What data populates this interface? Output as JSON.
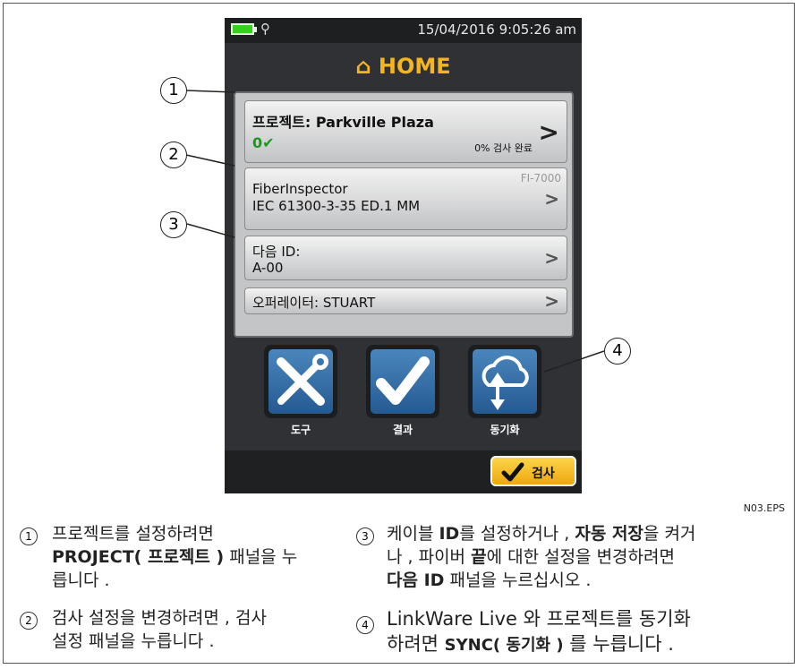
{
  "status": {
    "datetime": "15/04/2016 9:05:26 am"
  },
  "header": {
    "title": "HOME"
  },
  "project": {
    "title": "프로젝트: Parkville Plaza",
    "count": "0✔",
    "pct": "0% 검사 완료"
  },
  "test_setup": {
    "line1": "FiberInspector",
    "line2": "IEC 61300-3-35 ED.1 MM",
    "tag": "FI-7000"
  },
  "next_id": {
    "line1": "다음 ID:",
    "line2": "A-00"
  },
  "operator": {
    "label": "오퍼레이터: STUART"
  },
  "buttons": {
    "tools": "도구",
    "results": "결과",
    "sync": "동기화",
    "test": "검사"
  },
  "figure_id": "N03.EPS",
  "callouts": [
    "1",
    "2",
    "3",
    "4"
  ],
  "captions": {
    "c1_a": "프로젝트를 설정하려면",
    "c1_b_bold": "PROJECT( 프로젝트 )",
    "c1_b_rest": " 패널을 누",
    "c1_c": "릅니다 .",
    "c2_a": "검사 설정을 변경하려면 , 검사",
    "c2_b": "설정 패널을 누릅니다 .",
    "c3_a1": "케이블 ",
    "c3_a_bold1": "ID",
    "c3_a2": "를 설정하거나 , ",
    "c3_a_bold2": "자동 저장",
    "c3_a3": "을 켜거",
    "c3_b1": "나 , 파이버 ",
    "c3_b_bold": "끝",
    "c3_b2": "에 대한 설정을 변경하려면",
    "c3_c_bold": "다음 ID",
    "c3_c_rest": " 패널을 누르십시오 .",
    "c4_a": "LinkWare Live 와 프로젝트를 동기화",
    "c4_b1": "하려면 ",
    "c4_b_bold": "SYNC( 동기화 )",
    "c4_b2": " 를 누릅니다 ."
  }
}
